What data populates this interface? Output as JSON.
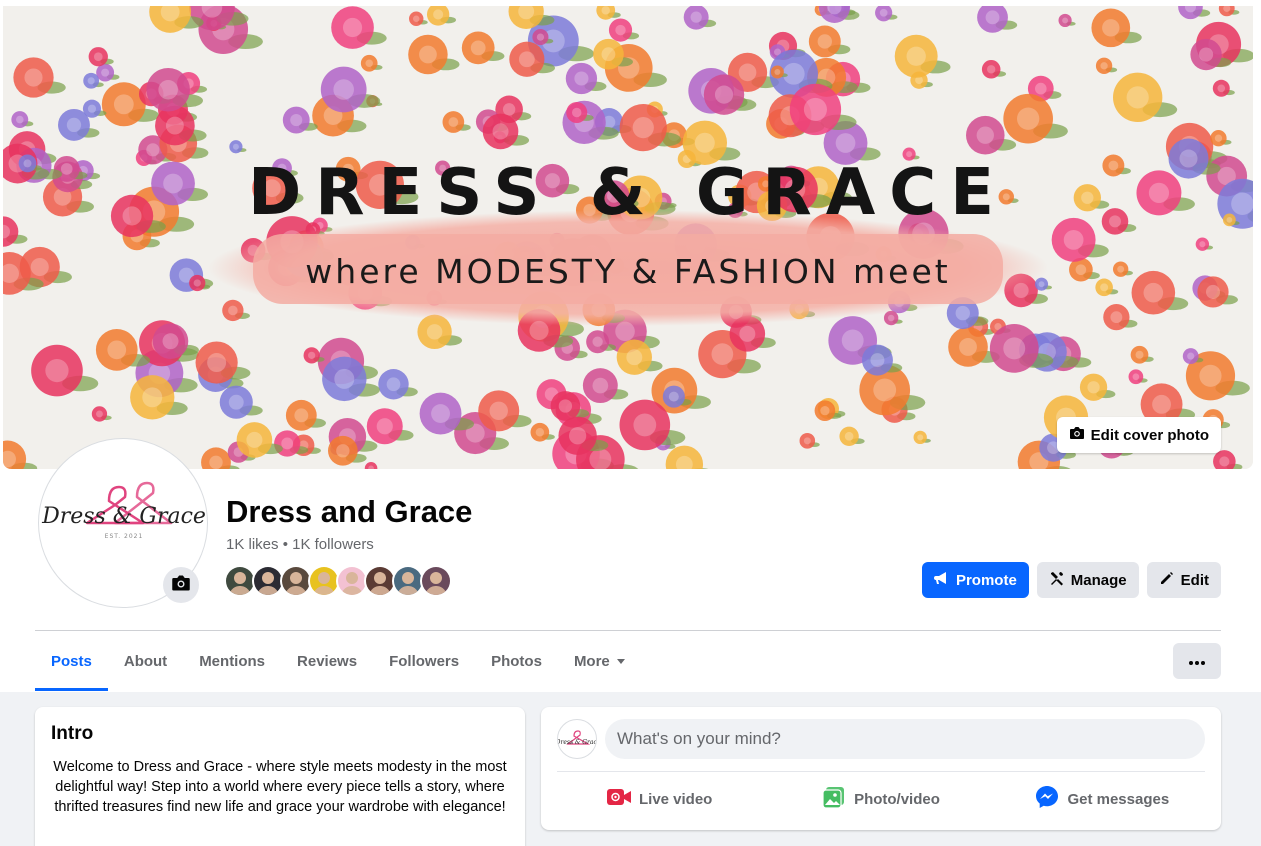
{
  "colors": {
    "brand_blue": "#0866ff",
    "live_red": "#e42645",
    "photo_green": "#45bd62",
    "messenger_blue": "#0866ff"
  },
  "cover": {
    "title": "DRESS & GRACE",
    "subtitle": "where MODESTY & FASHION meet",
    "edit_label": "Edit cover photo",
    "edit_icon": "camera-icon"
  },
  "logo": {
    "text": "Dress & Grace",
    "est": "EST. 2021"
  },
  "profile": {
    "name": "Dress and Grace",
    "stats": "1K likes • 1K followers",
    "follower_count_shown": 8
  },
  "actions": {
    "promote": "Promote",
    "manage": "Manage",
    "edit": "Edit"
  },
  "tabs": [
    {
      "label": "Posts",
      "active": true
    },
    {
      "label": "About",
      "active": false
    },
    {
      "label": "Mentions",
      "active": false
    },
    {
      "label": "Reviews",
      "active": false
    },
    {
      "label": "Followers",
      "active": false
    },
    {
      "label": "Photos",
      "active": false
    },
    {
      "label": "More",
      "active": false
    }
  ],
  "intro": {
    "title": "Intro",
    "text": "Welcome to Dress and Grace - where style meets modesty in the most delightful way! Step into a world where every piece tells a story, where thrifted treasures find new life and grace your wardrobe with elegance!"
  },
  "composer": {
    "placeholder": "What's on your mind?",
    "live": "Live video",
    "photo": "Photo/video",
    "messages": "Get messages"
  }
}
